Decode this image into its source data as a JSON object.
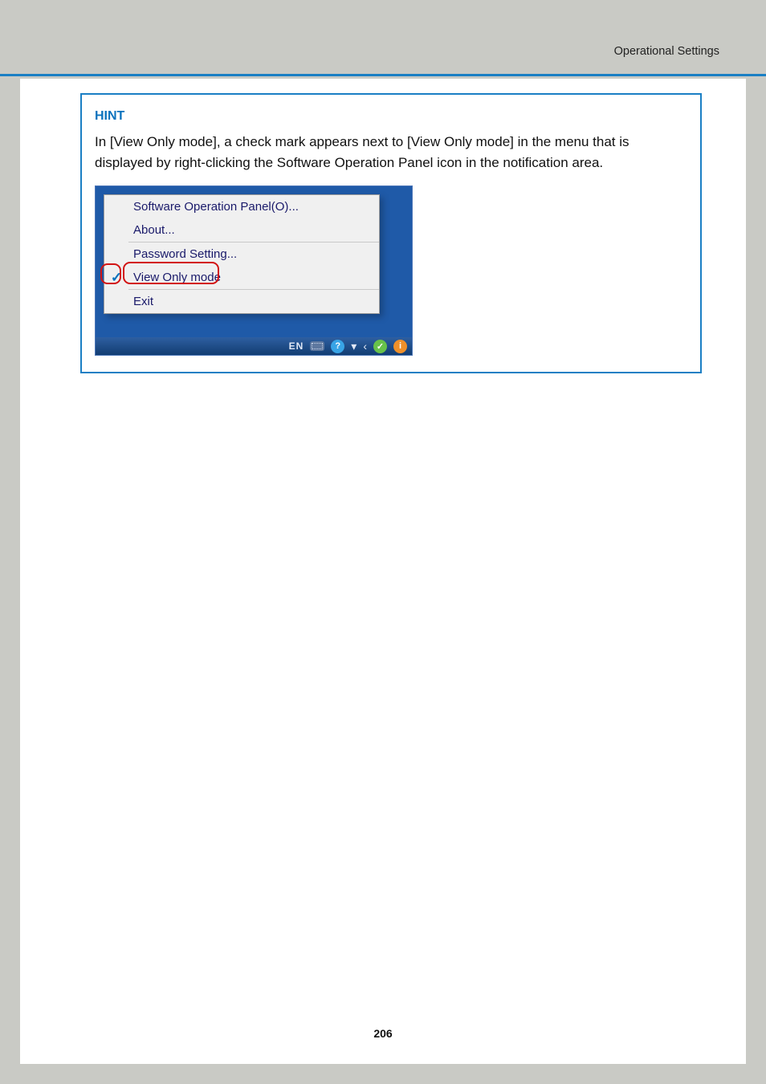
{
  "header": {
    "breadcrumb": "Operational Settings"
  },
  "hint": {
    "title": "HINT",
    "body": "In [View Only mode], a check mark appears next to [View Only mode] in the menu that is displayed by right-clicking the Software Operation Panel icon in the notification area."
  },
  "context_menu": {
    "items": [
      {
        "label": "Software Operation Panel(O)...",
        "checked": false
      },
      {
        "label": "About...",
        "checked": false
      },
      {
        "label": "Password Setting...",
        "checked": false
      },
      {
        "label": "View Only mode",
        "checked": true
      },
      {
        "label": "Exit",
        "checked": false
      }
    ]
  },
  "tray": {
    "language": "EN"
  },
  "page_number": "206"
}
